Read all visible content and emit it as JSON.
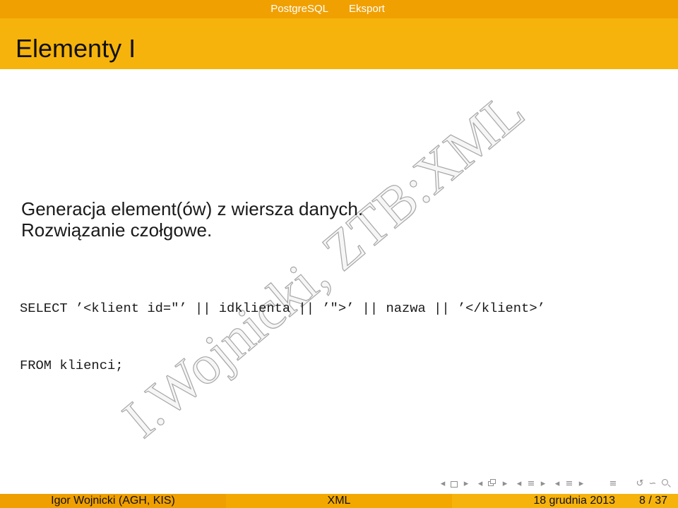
{
  "headline": {
    "section": "PostgreSQL",
    "subsection": "Eksport"
  },
  "frame": {
    "title": "Elementy I"
  },
  "body": {
    "lines": [
      "Generacja element(ów) z wiersza danych.",
      "Rozwiązanie czołgowe."
    ],
    "code": [
      "SELECT ’<klient id=\"’ || idklienta || ’\">’ || nazwa || ’</klient>’",
      "FROM klienci;"
    ]
  },
  "watermark": "I.Wojnicki, ZTB:XML",
  "nav_icons": [
    "nav-prev-slide-icon",
    "slide-icon",
    "nav-next-slide-icon",
    "nav-prev-frame-icon",
    "frame-icon",
    "nav-next-frame-icon",
    "nav-prev-subsection-icon",
    "subsection-icon",
    "nav-next-subsection-icon",
    "nav-prev-section-icon",
    "section-icon",
    "nav-next-section-icon",
    "document-icon",
    "back-icon",
    "forward-icon",
    "search-icon"
  ],
  "footer": {
    "author": "Igor Wojnicki (AGH, KIS)",
    "short_title": "XML",
    "date": "18 grudnia 2013",
    "page": "8 / 37"
  },
  "colors": {
    "headline_bg": "#f0a000",
    "title_bg": "#f6b30c",
    "author_bg": "#ef9f00",
    "short_title_bg": "#f3a800",
    "date_bg": "#f6b30c",
    "text": "#1a1a1a",
    "nav": "#8f8f8f",
    "watermark_stroke": "#a6a6a6"
  }
}
